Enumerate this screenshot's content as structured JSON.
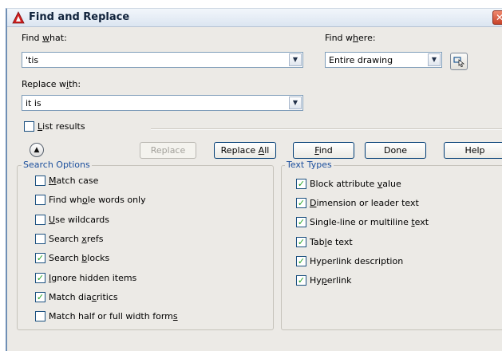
{
  "dialog": {
    "title": "Find and Replace"
  },
  "find_what": {
    "label_pre": "Find ",
    "label_u": "w",
    "label_post": "hat:",
    "value": "'tis"
  },
  "find_where": {
    "label_pre": "Find w",
    "label_u": "h",
    "label_post": "ere:",
    "value": "Entire drawing"
  },
  "replace_with": {
    "label_pre": "Replace w",
    "label_u": "i",
    "label_post": "th:",
    "value": "it is"
  },
  "list_results": {
    "u": "L",
    "post": "ist results",
    "checked": false
  },
  "buttons": {
    "replace": "Replace",
    "replace_all_pre": "Replace ",
    "replace_all_u": "A",
    "replace_all_post": "ll",
    "find_u": "F",
    "find_post": "ind",
    "done": "Done",
    "help": "Help"
  },
  "search_options": {
    "legend": "Search Options",
    "items": [
      {
        "pre": "",
        "u": "M",
        "post": "atch case",
        "checked": false
      },
      {
        "pre": "Find wh",
        "u": "o",
        "post": "le words only",
        "checked": false
      },
      {
        "pre": "",
        "u": "U",
        "post": "se wildcards",
        "checked": false
      },
      {
        "pre": "Search ",
        "u": "x",
        "post": "refs",
        "checked": false
      },
      {
        "pre": "Search ",
        "u": "b",
        "post": "locks",
        "checked": true
      },
      {
        "pre": "",
        "u": "I",
        "post": "gnore hidden items",
        "checked": true
      },
      {
        "pre": "Match dia",
        "u": "c",
        "post": "ritics",
        "checked": true
      },
      {
        "pre": "Match half or full width form",
        "u": "s",
        "post": "",
        "checked": false
      }
    ]
  },
  "text_types": {
    "legend": "Text Types",
    "items": [
      {
        "pre": "Block attribute ",
        "u": "v",
        "post": "alue",
        "checked": true
      },
      {
        "pre": "",
        "u": "D",
        "post": "imension or leader text",
        "checked": true
      },
      {
        "pre": "Single-line or multiline ",
        "u": "t",
        "post": "ext",
        "checked": true
      },
      {
        "pre": "Tab",
        "u": "l",
        "post": "e text",
        "checked": true
      },
      {
        "pre": "Hyperlink description",
        "u": "",
        "post": "",
        "checked": true
      },
      {
        "pre": "Hy",
        "u": "p",
        "post": "erlink",
        "checked": true
      }
    ]
  },
  "colors": {
    "dialog_bg": "#eceae6",
    "group_legend": "#1a4e9c",
    "check_mark": "#21a121"
  }
}
